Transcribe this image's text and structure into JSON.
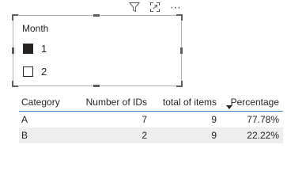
{
  "visual_header": {
    "icons": [
      "filter-icon",
      "focus-mode-icon",
      "more-options-icon"
    ],
    "more_glyph": "⋯"
  },
  "slicer": {
    "title": "Month",
    "items": [
      {
        "label": "1",
        "checked": true
      },
      {
        "label": "2",
        "checked": false
      }
    ]
  },
  "table": {
    "headers": [
      "Category",
      "Number of IDs",
      "total of items",
      "Percentage"
    ],
    "sorted_column": "Percentage",
    "rows": [
      [
        "A",
        "7",
        "9",
        "77.78%"
      ],
      [
        "B",
        "2",
        "9",
        "22.22%"
      ]
    ]
  },
  "colors": {
    "header_underline": "#3c82c4",
    "alt_row": "#eeeeee",
    "text": "#252423"
  }
}
